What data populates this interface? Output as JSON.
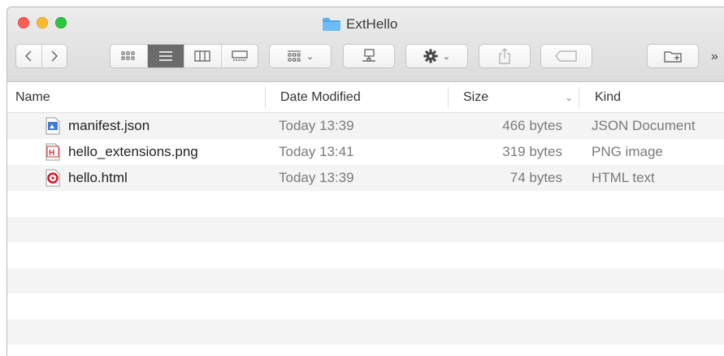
{
  "window": {
    "title": "ExtHello"
  },
  "toolbar": {
    "back_icon": "chevron-left-icon",
    "forward_icon": "chevron-right-icon",
    "views": [
      "icon-view-icon",
      "list-view-icon",
      "column-view-icon",
      "gallery-view-icon"
    ],
    "active_view": "list-view-icon",
    "group_icon": "group-by-icon",
    "share_drive_icon": "network-drive-icon",
    "action_icon": "gear-icon",
    "share_icon": "share-icon",
    "tag_icon": "tag-icon",
    "new_folder_icon": "new-folder-icon",
    "overflow_label": "»"
  },
  "columns": {
    "name": "Name",
    "date": "Date Modified",
    "size": "Size",
    "kind": "Kind"
  },
  "files": [
    {
      "name": "manifest.json",
      "date": "Today 13:39",
      "size": "466 bytes",
      "kind": "JSON Document",
      "icon": "json-file-icon"
    },
    {
      "name": "hello_extensions.png",
      "date": "Today 13:41",
      "size": "319 bytes",
      "kind": "PNG image",
      "icon": "png-file-icon"
    },
    {
      "name": "hello.html",
      "date": "Today 13:39",
      "size": "74 bytes",
      "kind": "HTML text",
      "icon": "html-file-icon"
    }
  ],
  "colors": {
    "close": "#fd5f57",
    "minimize": "#fdbc2e",
    "maximize": "#28c840",
    "folder": "#6cbcf5",
    "row_alt": "#f4f4f4"
  }
}
